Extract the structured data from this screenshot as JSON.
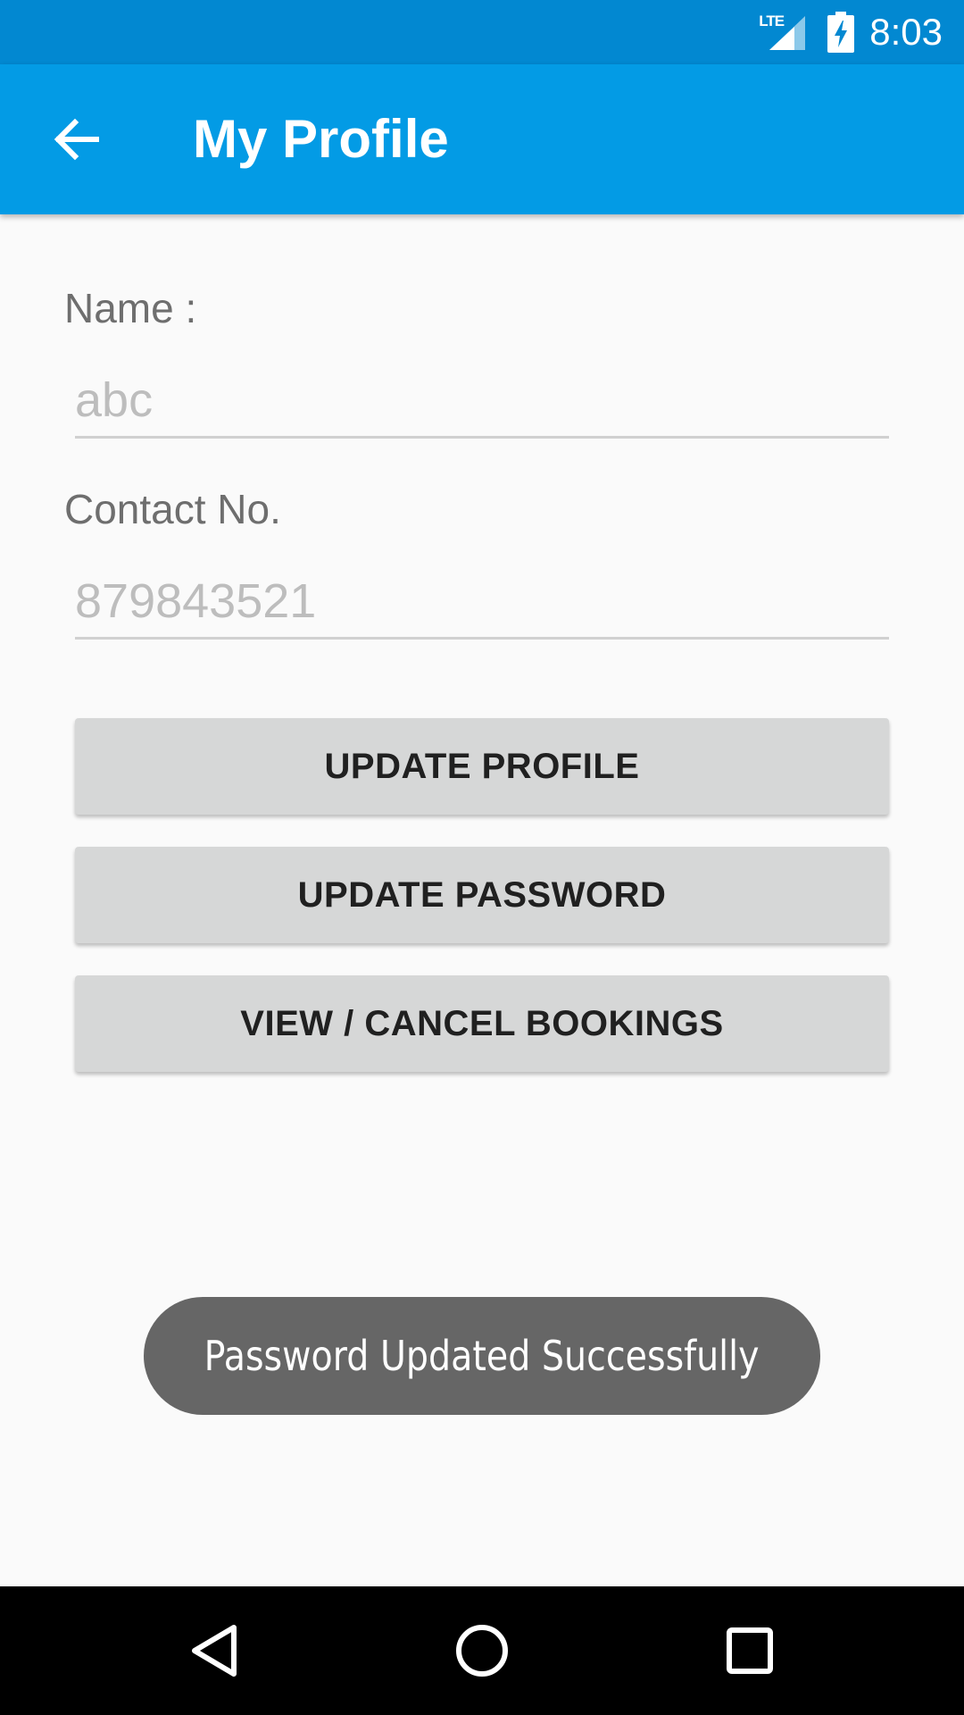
{
  "status_bar": {
    "network_label": "LTE",
    "time": "8:03",
    "icons": [
      "lte-signal-icon",
      "battery-charging-icon"
    ]
  },
  "app_bar": {
    "title": "My Profile",
    "back_icon": "arrow-back-icon",
    "color": "#039be5"
  },
  "form": {
    "name_label": "Name :",
    "name_placeholder": "abc",
    "contact_label": "Contact No.",
    "contact_placeholder": "879843521"
  },
  "buttons": {
    "update_profile": "UPDATE PROFILE",
    "update_password": "UPDATE PASSWORD",
    "view_cancel_bookings": "VIEW / CANCEL BOOKINGS"
  },
  "toast": {
    "message": "Password Updated Successfully"
  },
  "nav_bar": {
    "icons": [
      "back-triangle-icon",
      "home-circle-icon",
      "recents-square-icon"
    ]
  },
  "colors": {
    "status_bar": "#0288d1",
    "app_bar": "#039be5",
    "background": "#fafafa",
    "button": "#d6d7d7",
    "toast": "#666666"
  }
}
